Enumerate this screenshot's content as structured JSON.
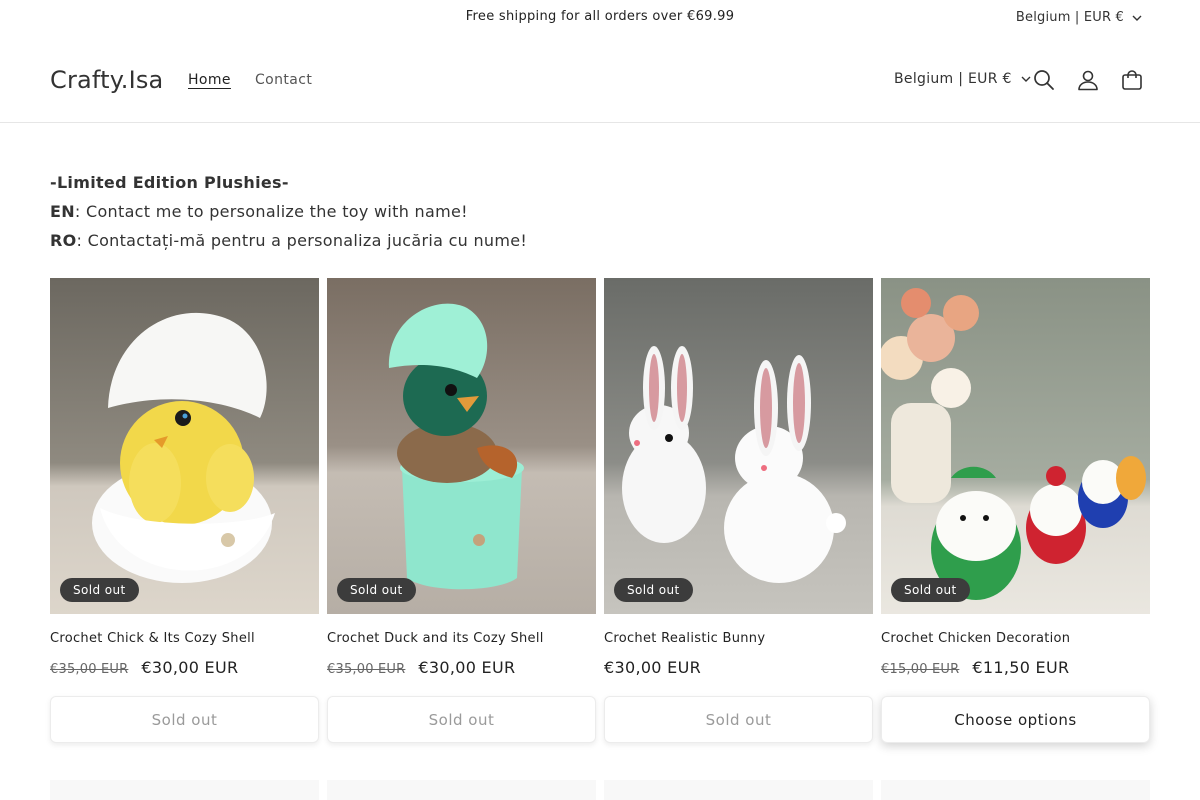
{
  "announcement": {
    "text": "Free shipping for all orders over €69.99",
    "locale": "Belgium | EUR €"
  },
  "header": {
    "logo": "Crafty.Isa",
    "nav": [
      {
        "label": "Home",
        "active": true
      },
      {
        "label": "Contact",
        "active": false
      }
    ],
    "locale": "Belgium | EUR €",
    "icons": [
      "search-icon",
      "account-icon",
      "cart-icon"
    ]
  },
  "intro": {
    "heading": "-Limited Edition Plushies-",
    "line1_prefix": "EN",
    "line1_text": ": Contact me to personalize the toy with name!",
    "line2_prefix": "RO",
    "line2_text": ": Contactați-mă pentru a personaliza jucăria cu nume!"
  },
  "products": [
    {
      "title": "Crochet Chick & Its Cozy Shell",
      "badge": "Sold out",
      "price_old": "€35,00 EUR",
      "price": "€30,00 EUR",
      "button": "Sold out"
    },
    {
      "title": "Crochet Duck and its Cozy Shell",
      "badge": "Sold out",
      "price_old": "€35,00 EUR",
      "price": "€30,00 EUR",
      "button": "Sold out"
    },
    {
      "title": "Crochet Realistic Bunny",
      "badge": "Sold out",
      "price_old": "",
      "price": "€30,00 EUR",
      "button": "Sold out"
    },
    {
      "title": "Crochet Chicken Decoration",
      "badge": "Sold out",
      "price_old": "€15,00 EUR",
      "price": "€11,50 EUR",
      "button": "Choose options"
    }
  ]
}
